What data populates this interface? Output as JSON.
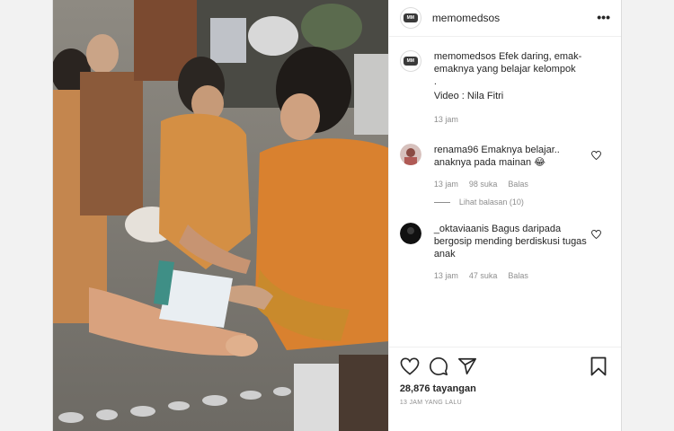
{
  "post": {
    "username": "memomedsos",
    "logo_text": "MM",
    "more_label": "•••"
  },
  "caption": {
    "username": "memomedsos",
    "text": "Efek daring, emak-emaknya yang belajar kelompok",
    "dot": ".",
    "credit": "Video : Nila Fitri",
    "time": "13 jam"
  },
  "comments": [
    {
      "username": "renama96",
      "text": "Emaknya belajar.. anaknya pada mainan 😂",
      "time": "13 jam",
      "likes": "98 suka",
      "reply_label": "Balas",
      "avatar_color": "#c9a7a0"
    },
    {
      "username": "_oktaviaanis",
      "text": "Bagus daripada bergosip mending berdiskusi tugas anak",
      "time": "13 jam",
      "likes": "47 suka",
      "reply_label": "Balas",
      "avatar_color": "#1a1a1a"
    }
  ],
  "view_replies": "Lihat balasan (10)",
  "stats": {
    "views": "28,876 tayangan",
    "time_ago": "13 JAM YANG LALU"
  },
  "icons": {
    "like": "heart-icon",
    "comment": "comment-icon",
    "share": "share-icon",
    "save": "bookmark-icon",
    "more": "more-icon"
  },
  "colors": {
    "text": "#262626",
    "secondary": "#8e8e8e",
    "border": "#efefef"
  }
}
